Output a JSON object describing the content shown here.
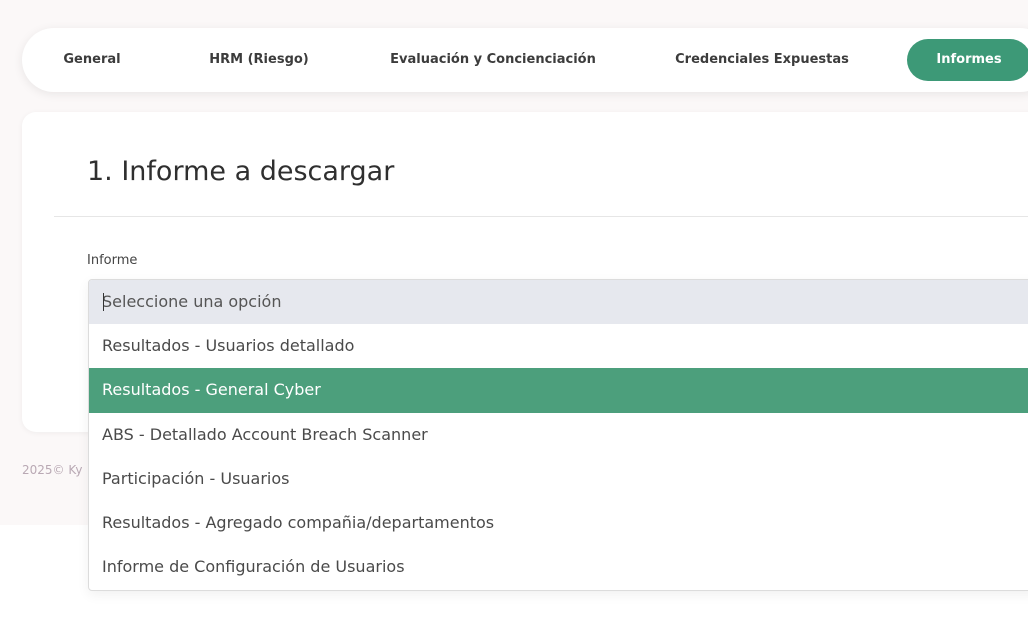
{
  "tabs": [
    {
      "label": "General",
      "active": false
    },
    {
      "label": "HRM (Riesgo)",
      "active": false
    },
    {
      "label": "Evaluación y Concienciación",
      "active": false
    },
    {
      "label": "Credenciales Expuestas",
      "active": false
    },
    {
      "label": "Informes",
      "active": true
    }
  ],
  "section": {
    "title": "1. Informe a descargar",
    "field_label": "Informe"
  },
  "dropdown": {
    "placeholder": "Seleccione una opción",
    "value": "",
    "selected_option": "Resultados - General Cyber",
    "options": [
      "Resultados - Usuarios detallado",
      "Resultados - General Cyber",
      "ABS - Detallado Account Breach Scanner",
      "Participación - Usuarios",
      "Resultados - Agregado compañia/departamentos",
      "Informe de Configuración de Usuarios"
    ]
  },
  "footer": {
    "text": "2025© Ky"
  },
  "colors": {
    "accent": "#3d9977",
    "highlight": "#4c9f7c",
    "search_bg": "#e6e8ee"
  }
}
